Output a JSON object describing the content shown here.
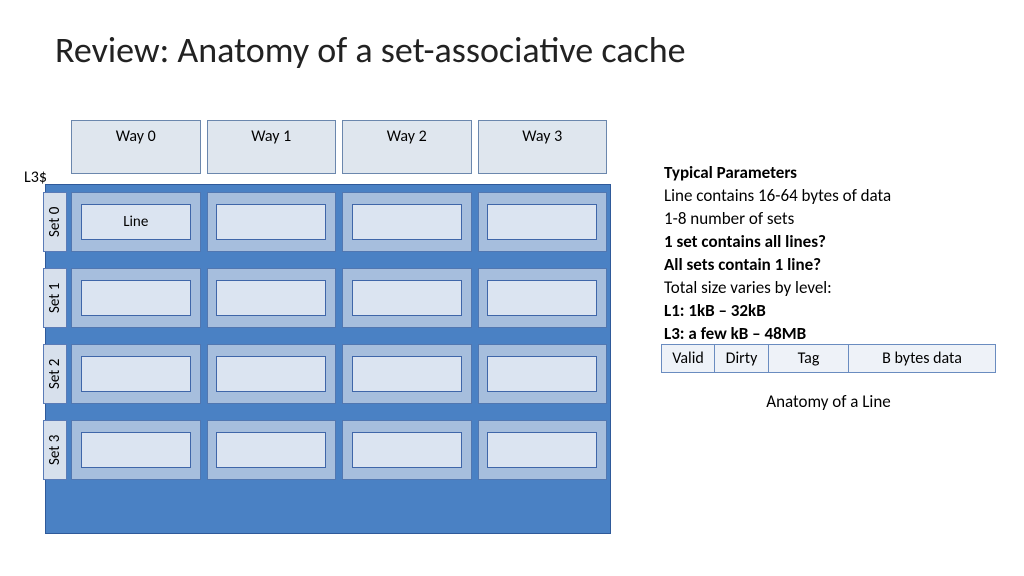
{
  "title": "Review: Anatomy of a set-associative cache",
  "l3_label": "L3$",
  "ways": [
    "Way 0",
    "Way 1",
    "Way 2",
    "Way 3"
  ],
  "sets": [
    "Set 0",
    "Set 1",
    "Set 2",
    "Set 3"
  ],
  "line_label": "Line",
  "info": {
    "heading": "Typical Parameters",
    "lines": [
      {
        "text": "Line contains 16-64 bytes of data",
        "bold": false
      },
      {
        "text": "1-8 number of sets",
        "bold": false
      },
      {
        "text": "1 set contains all lines?",
        "bold": true
      },
      {
        "text": "All sets contain 1 line?",
        "bold": true
      },
      {
        "text": "Total size varies by level:",
        "bold": false
      },
      {
        "text": "L1: 1kB – 32kB",
        "bold": true
      },
      {
        "text": "L3: a few kB – 48MB",
        "bold": true
      }
    ]
  },
  "line_anatomy": {
    "cells": {
      "valid": "Valid",
      "dirty": "Dirty",
      "tag": "Tag",
      "data": "B bytes data"
    },
    "caption": "Anatomy of a Line"
  }
}
